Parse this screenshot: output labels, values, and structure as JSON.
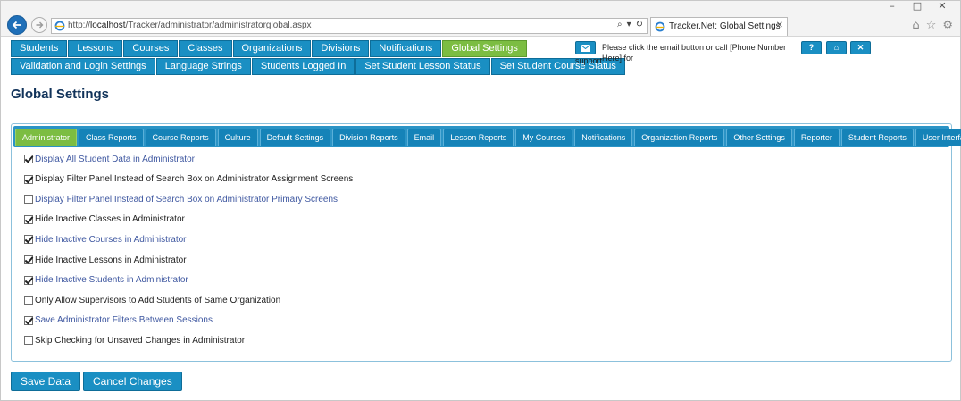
{
  "browser": {
    "url_prefix": "http://",
    "url_host": "localhost",
    "url_path": "/Tracker/administrator/administratorglobal.aspx",
    "tab_title": "Tracker.Net: Global Settings"
  },
  "nav": {
    "row1": [
      "Students",
      "Lessons",
      "Courses",
      "Classes",
      "Organizations",
      "Divisions",
      "Notifications",
      "Global Settings"
    ],
    "active_row1": "Global Settings",
    "row2": [
      "Validation and Login Settings",
      "Language Strings",
      "Students Logged In",
      "Set Student Lesson Status",
      "Set Student Course Status"
    ]
  },
  "support": {
    "text_line1": "Please click the email button or call [Phone Number Here] for",
    "text_line2": "support.",
    "help_label": "?",
    "home_label": "⌂",
    "close_label": "✕"
  },
  "page_title": "Global Settings",
  "subtabs": [
    "Administrator",
    "Class Reports",
    "Course Reports",
    "Culture",
    "Default Settings",
    "Division Reports",
    "Email",
    "Lesson Reports",
    "My Courses",
    "Notifications",
    "Organization Reports",
    "Other Settings",
    "Reporter",
    "Student Reports",
    "User Interface"
  ],
  "active_subtab": "Administrator",
  "options": [
    {
      "label": "Display All Student Data in Administrator",
      "checked": true,
      "link": true
    },
    {
      "label": "Display Filter Panel Instead of Search Box on Administrator Assignment Screens",
      "checked": true,
      "link": false
    },
    {
      "label": "Display Filter Panel Instead of Search Box on Administrator Primary Screens",
      "checked": false,
      "link": true
    },
    {
      "label": "Hide Inactive Classes in Administrator",
      "checked": true,
      "link": false
    },
    {
      "label": "Hide Inactive Courses in Administrator",
      "checked": true,
      "link": true
    },
    {
      "label": "Hide Inactive Lessons in Administrator",
      "checked": true,
      "link": false
    },
    {
      "label": "Hide Inactive Students in Administrator",
      "checked": true,
      "link": true
    },
    {
      "label": "Only Allow Supervisors to Add Students of Same Organization",
      "checked": false,
      "link": false
    },
    {
      "label": "Save Administrator Filters Between Sessions",
      "checked": true,
      "link": true
    },
    {
      "label": "Skip Checking for Unsaved Changes in Administrator",
      "checked": false,
      "link": false
    }
  ],
  "actions": {
    "save_label": "Save Data",
    "cancel_label": "Cancel Changes"
  },
  "colors": {
    "nav_blue": "#1a8fc3",
    "active_green": "#7cbd42",
    "title_navy": "#11335a",
    "link_blue": "#3e57a0"
  }
}
